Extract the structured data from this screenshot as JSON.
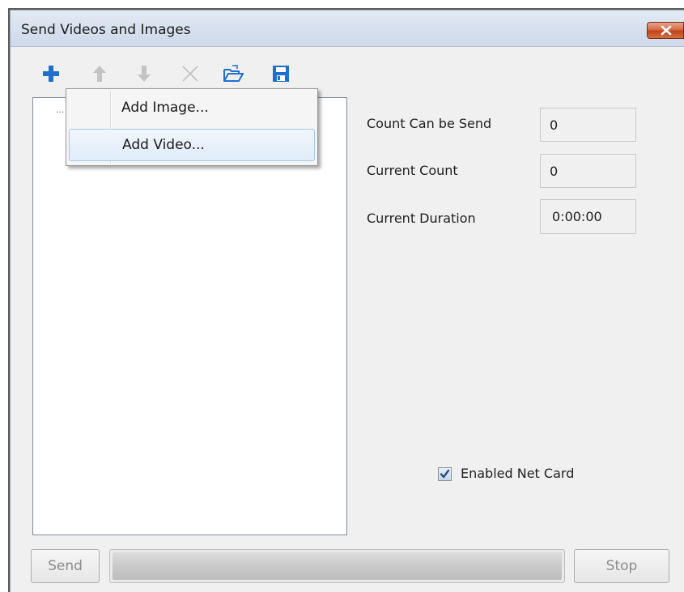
{
  "window": {
    "title": "Send Videos and Images",
    "close_icon": "close-icon"
  },
  "toolbar": {
    "items": [
      {
        "icon": "add-icon",
        "state": "active",
        "color": "#1f6fd1"
      },
      {
        "icon": "move-up-icon",
        "state": "disabled"
      },
      {
        "icon": "move-down-icon",
        "state": "disabled"
      },
      {
        "icon": "delete-icon",
        "state": "disabled"
      },
      {
        "icon": "open-folder-icon",
        "state": "active",
        "color": "#1f6fd1"
      },
      {
        "icon": "save-icon",
        "state": "active",
        "color": "#1f6fd1"
      }
    ]
  },
  "tree": {
    "root_text": "..."
  },
  "context_menu": {
    "items": [
      {
        "label": "Add Image..."
      },
      {
        "label": "Add Video...",
        "hovered": true
      }
    ]
  },
  "info": {
    "count_can_be_send_label": "Count Can be Send",
    "count_can_be_send_value": "0",
    "current_count_label": "Current Count",
    "current_count_value": "0",
    "current_duration_label": "Current Duration",
    "current_duration_value": "0:00:00"
  },
  "net_card": {
    "label": "Enabled Net Card",
    "checked": true
  },
  "footer": {
    "send_label": "Send",
    "stop_label": "Stop",
    "progress": 1.0
  },
  "colors": {
    "accent": "#1f6fd1",
    "close_button": "#c84a24",
    "menu_hover": "#e0ecfa"
  }
}
